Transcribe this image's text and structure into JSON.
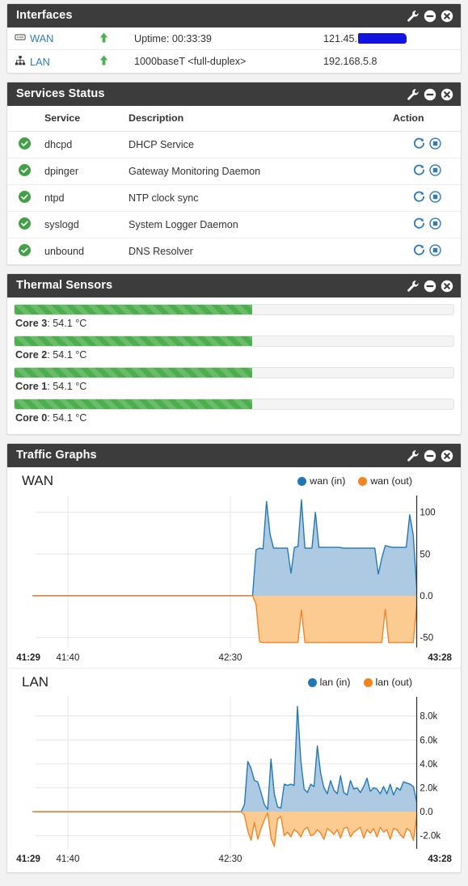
{
  "panels": {
    "interfaces": {
      "title": "Interfaces"
    },
    "services": {
      "title": "Services Status"
    },
    "thermal": {
      "title": "Thermal Sensors"
    },
    "traffic": {
      "title": "Traffic Graphs"
    }
  },
  "tools": {
    "settings": "wrench-icon",
    "minimize": "minus-circle-icon",
    "close": "close-circle-icon"
  },
  "interfaces": {
    "rows": [
      {
        "name": "WAN",
        "icon": "server-icon",
        "status": "up",
        "desc": "Uptime: 00:33:39",
        "ip": "121.45.",
        "redacted": true
      },
      {
        "name": "LAN",
        "icon": "sitemap-icon",
        "status": "up",
        "desc": "1000baseT <full-duplex>",
        "ip": "192.168.5.8",
        "redacted": false
      }
    ]
  },
  "services": {
    "headers": {
      "status": "",
      "service": "Service",
      "description": "Description",
      "action": "Action"
    },
    "rows": [
      {
        "status": "running",
        "name": "dhcpd",
        "description": "DHCP Service"
      },
      {
        "status": "running",
        "name": "dpinger",
        "description": "Gateway Monitoring Daemon"
      },
      {
        "status": "running",
        "name": "ntpd",
        "description": "NTP clock sync"
      },
      {
        "status": "running",
        "name": "syslogd",
        "description": "System Logger Daemon"
      },
      {
        "status": "running",
        "name": "unbound",
        "description": "DNS Resolver"
      }
    ],
    "actions": {
      "restart": "restart-icon",
      "stop": "stop-icon"
    }
  },
  "thermal": {
    "sensors": [
      {
        "label": "Core 3",
        "value": "54.1 °C",
        "percent": 54.1
      },
      {
        "label": "Core 2",
        "value": "54.1 °C",
        "percent": 54.1
      },
      {
        "label": "Core 1",
        "value": "54.1 °C",
        "percent": 54.1
      },
      {
        "label": "Core 0",
        "value": "54.1 °C",
        "percent": 54.1
      }
    ]
  },
  "colors": {
    "panel_header": "#3c3c3c",
    "link": "#337ab7",
    "up_arrow": "#4caf50",
    "progress_green": "#4cae4c",
    "series_in": "#1f77b4",
    "series_out": "#f5821f",
    "area_in": "#aac7e0",
    "area_out": "#fbc88c",
    "redaction": "#1414e0"
  },
  "chart_data": [
    {
      "type": "area",
      "title": "WAN",
      "xlabel": "",
      "ylabel": "",
      "grid": true,
      "legend_position": "top-right",
      "legend": [
        "wan (in)",
        "wan (out)"
      ],
      "series": [
        {
          "name": "wan (in)",
          "color": "#1f77b4",
          "values": [
            0,
            0,
            0,
            0,
            0,
            0,
            0,
            0,
            0,
            0,
            0,
            0,
            0,
            0,
            0,
            0,
            0,
            0,
            0,
            0,
            0,
            0,
            0,
            0,
            0,
            0,
            0,
            0,
            0,
            0,
            0,
            0,
            0,
            0,
            0,
            0,
            0,
            0,
            0,
            0,
            0,
            0,
            0,
            0,
            0,
            0,
            0,
            0,
            0,
            0,
            0,
            0,
            0,
            0,
            0,
            0,
            0,
            0,
            0,
            0,
            0,
            0,
            0,
            0,
            55,
            57,
            56,
            113,
            74,
            57,
            57,
            57,
            57,
            57,
            27,
            58,
            59,
            115,
            57,
            57,
            57,
            100,
            58,
            58,
            58,
            58,
            58,
            58,
            58,
            57,
            57,
            57,
            57,
            57,
            57,
            57,
            57,
            57,
            57,
            26,
            45,
            60,
            59,
            58,
            58,
            58,
            58,
            58,
            97,
            73,
            10
          ]
        },
        {
          "name": "wan (out)",
          "color": "#f5821f",
          "values": [
            0,
            0,
            0,
            0,
            0,
            0,
            0,
            0,
            0,
            0,
            0,
            0,
            0,
            0,
            0,
            0,
            0,
            0,
            0,
            0,
            0,
            0,
            0,
            0,
            0,
            0,
            0,
            0,
            0,
            0,
            0,
            0,
            0,
            0,
            0,
            0,
            0,
            0,
            0,
            0,
            0,
            0,
            0,
            0,
            0,
            0,
            0,
            0,
            0,
            0,
            0,
            0,
            0,
            0,
            0,
            0,
            0,
            0,
            0,
            0,
            0,
            0,
            0,
            0,
            -10,
            -55,
            -56,
            -56,
            -56,
            -56,
            -56,
            -56,
            -56,
            -56,
            -56,
            -56,
            -56,
            -17,
            -56,
            -56,
            -56,
            -56,
            -56,
            -56,
            -56,
            -56,
            -56,
            -56,
            -56,
            -56,
            -56,
            -56,
            -56,
            -56,
            -56,
            -56,
            -56,
            -56,
            -56,
            -56,
            -56,
            -16,
            -56,
            -56,
            -56,
            -56,
            -56,
            -56,
            -56,
            -56,
            -12
          ]
        }
      ],
      "ytick_labels": [
        "100",
        "50",
        "0.0",
        "-50"
      ],
      "ytick_values": [
        100,
        50,
        0,
        -50
      ],
      "ylim": [
        -62,
        120
      ],
      "xtick_labels": [
        "41:29",
        "41:40",
        "42:30",
        "43:28"
      ],
      "xtick_positions": [
        0,
        9.2,
        51.5,
        100
      ]
    },
    {
      "type": "area",
      "title": "LAN",
      "xlabel": "",
      "ylabel": "",
      "grid": true,
      "legend_position": "top-right",
      "legend": [
        "lan (in)",
        "lan (out)"
      ],
      "series": [
        {
          "name": "lan (in)",
          "color": "#1f77b4",
          "values": [
            0,
            0,
            0,
            0,
            0,
            0,
            0,
            0,
            0,
            0,
            0,
            0,
            0,
            0,
            0,
            0,
            0,
            0,
            0,
            0,
            0,
            0,
            0,
            0,
            0,
            0,
            0,
            0,
            0,
            0,
            0,
            0,
            0,
            0,
            0,
            0,
            0,
            0,
            0,
            0,
            0,
            0,
            0,
            0,
            0,
            0,
            0,
            0,
            0,
            0,
            0,
            0,
            0,
            0,
            0,
            0,
            0,
            0,
            0,
            0,
            0,
            0,
            0,
            0,
            600,
            4200,
            3600,
            2600,
            2500,
            1600,
            600,
            200,
            4400,
            1500,
            400,
            300,
            2300,
            2200,
            2300,
            2200,
            8800,
            4300,
            1900,
            1600,
            2300,
            2100,
            5500,
            3200,
            2000,
            1500,
            2600,
            1800,
            1500,
            3000,
            1600,
            1400,
            2600,
            1900,
            2000,
            1600,
            2100,
            2800,
            1700,
            2000,
            1900,
            1500,
            2100,
            1500,
            2300,
            1400,
            2000,
            1800,
            2500,
            2400,
            2300,
            2100,
            800
          ]
        },
        {
          "name": "lan (out)",
          "color": "#f5821f",
          "values": [
            0,
            0,
            0,
            0,
            0,
            0,
            0,
            0,
            0,
            0,
            0,
            0,
            0,
            0,
            0,
            0,
            0,
            0,
            0,
            0,
            0,
            0,
            0,
            0,
            0,
            0,
            0,
            0,
            0,
            0,
            0,
            0,
            0,
            0,
            0,
            0,
            0,
            0,
            0,
            0,
            0,
            0,
            0,
            0,
            0,
            0,
            0,
            0,
            0,
            0,
            0,
            0,
            0,
            0,
            0,
            0,
            0,
            0,
            0,
            0,
            0,
            0,
            0,
            0,
            -300,
            -1600,
            -2400,
            -900,
            -2300,
            -1400,
            -700,
            -100,
            -2200,
            -2900,
            -600,
            -400,
            -2000,
            -1700,
            -2100,
            -1500,
            -1700,
            -2100,
            -1500,
            -1300,
            -2000,
            -1900,
            -1500,
            -1800,
            -2300,
            -1400,
            -1600,
            -1900,
            -1500,
            -2200,
            -1400,
            -1300,
            -2100,
            -1700,
            -1500,
            -1300,
            -2200,
            -1500,
            -1800,
            -1400,
            -2100,
            -1300,
            -1700,
            -1500,
            -2300,
            -1400,
            -1500,
            -1900,
            -2200,
            -1400,
            -1600,
            -2400,
            -400
          ]
        }
      ],
      "ytick_labels": [
        "8.0k",
        "6.0k",
        "4.0k",
        "2.0k",
        "0.0",
        "-2.0k"
      ],
      "ytick_values": [
        8000,
        6000,
        4000,
        2000,
        0,
        -2000
      ],
      "ylim": [
        -3100,
        9600
      ],
      "xtick_labels": [
        "41:29",
        "41:40",
        "42:30",
        "43:28"
      ],
      "xtick_positions": [
        0,
        9.2,
        51.5,
        100
      ]
    }
  ]
}
